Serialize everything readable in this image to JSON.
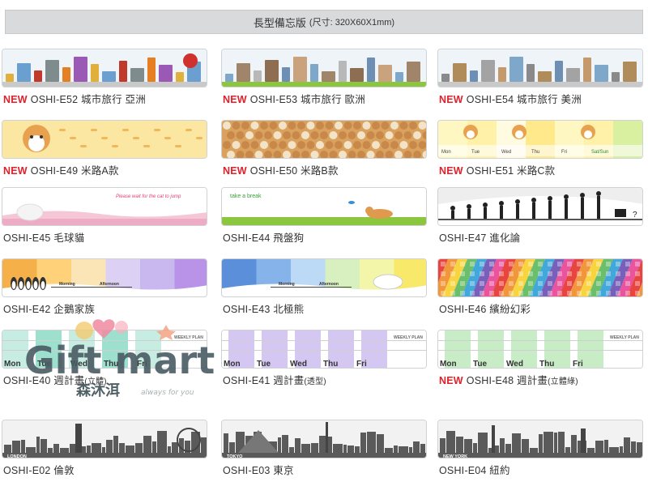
{
  "header": {
    "title": "長型備忘版",
    "dimensions": "(尺寸: 320X60X1mm)"
  },
  "items": [
    {
      "new": "NEW",
      "code": "OSHI-E52",
      "name": "城市旅行 亞洲",
      "sub": "",
      "theme": "asia"
    },
    {
      "new": "NEW",
      "code": "OSHI-E53",
      "name": "城市旅行 歐洲",
      "sub": "",
      "theme": "europe"
    },
    {
      "new": "NEW",
      "code": "OSHI-E54",
      "name": "城市旅行 美洲",
      "sub": "",
      "theme": "america"
    },
    {
      "new": "NEW",
      "code": "OSHI-E49",
      "name": "米路A款",
      "sub": "",
      "theme": "shibaA"
    },
    {
      "new": "NEW",
      "code": "OSHI-E50",
      "name": "米路B款",
      "sub": "",
      "theme": "shibaB"
    },
    {
      "new": "NEW",
      "code": "OSHI-E51",
      "name": "米路C款",
      "sub": "",
      "theme": "shibaC"
    },
    {
      "new": "",
      "code": "OSHI-E45",
      "name": "毛球貓",
      "sub": "",
      "theme": "cat"
    },
    {
      "new": "",
      "code": "OSHI-E44",
      "name": "飛盤狗",
      "sub": "",
      "theme": "dog"
    },
    {
      "new": "",
      "code": "OSHI-E47",
      "name": "進化論",
      "sub": "",
      "theme": "evolution"
    },
    {
      "new": "",
      "code": "OSHI-E42",
      "name": "企鵝家族",
      "sub": "",
      "theme": "penguin"
    },
    {
      "new": "",
      "code": "OSHI-E43",
      "name": "北極熊",
      "sub": "",
      "theme": "polar"
    },
    {
      "new": "",
      "code": "OSHI-E46",
      "name": "繽紛幻彩",
      "sub": "",
      "theme": "colorful"
    },
    {
      "new": "",
      "code": "OSHI-E40",
      "name": "週計畫",
      "sub": "(立體)",
      "theme": "weekA"
    },
    {
      "new": "",
      "code": "OSHI-E41",
      "name": "週計畫",
      "sub": "(透型)",
      "theme": "weekB"
    },
    {
      "new": "NEW",
      "code": "OSHI-E48",
      "name": "週計畫",
      "sub": "(立體綠)",
      "theme": "weekC"
    },
    {
      "new": "",
      "code": "OSHI-E02",
      "name": "倫敦",
      "sub": "",
      "theme": "london"
    },
    {
      "new": "",
      "code": "OSHI-E03",
      "name": "東京",
      "sub": "",
      "theme": "tokyo"
    },
    {
      "new": "",
      "code": "OSHI-E04",
      "name": "紐約",
      "sub": "",
      "theme": "newyork"
    }
  ],
  "thumb_text": {
    "cat_phrase": "Please wait for the cat to jump",
    "dog_phrase": "take a break",
    "morning": "Morning",
    "afternoon": "Afternoon",
    "weekly_plan": "WEEKLY PLAN",
    "days": [
      "Mon",
      "Tue",
      "Wed",
      "Thu",
      "Fri"
    ],
    "days_c": [
      "Mon",
      "Tue",
      "Wed",
      "Thu",
      "Fri",
      "Sat/Sun"
    ],
    "london": "LONDON",
    "tokyo": "TOKYO",
    "newyork": "NEW YORK"
  },
  "watermark": {
    "brand": "Gift mart",
    "chinese": "森沐洱",
    "tagline": "always for you"
  }
}
